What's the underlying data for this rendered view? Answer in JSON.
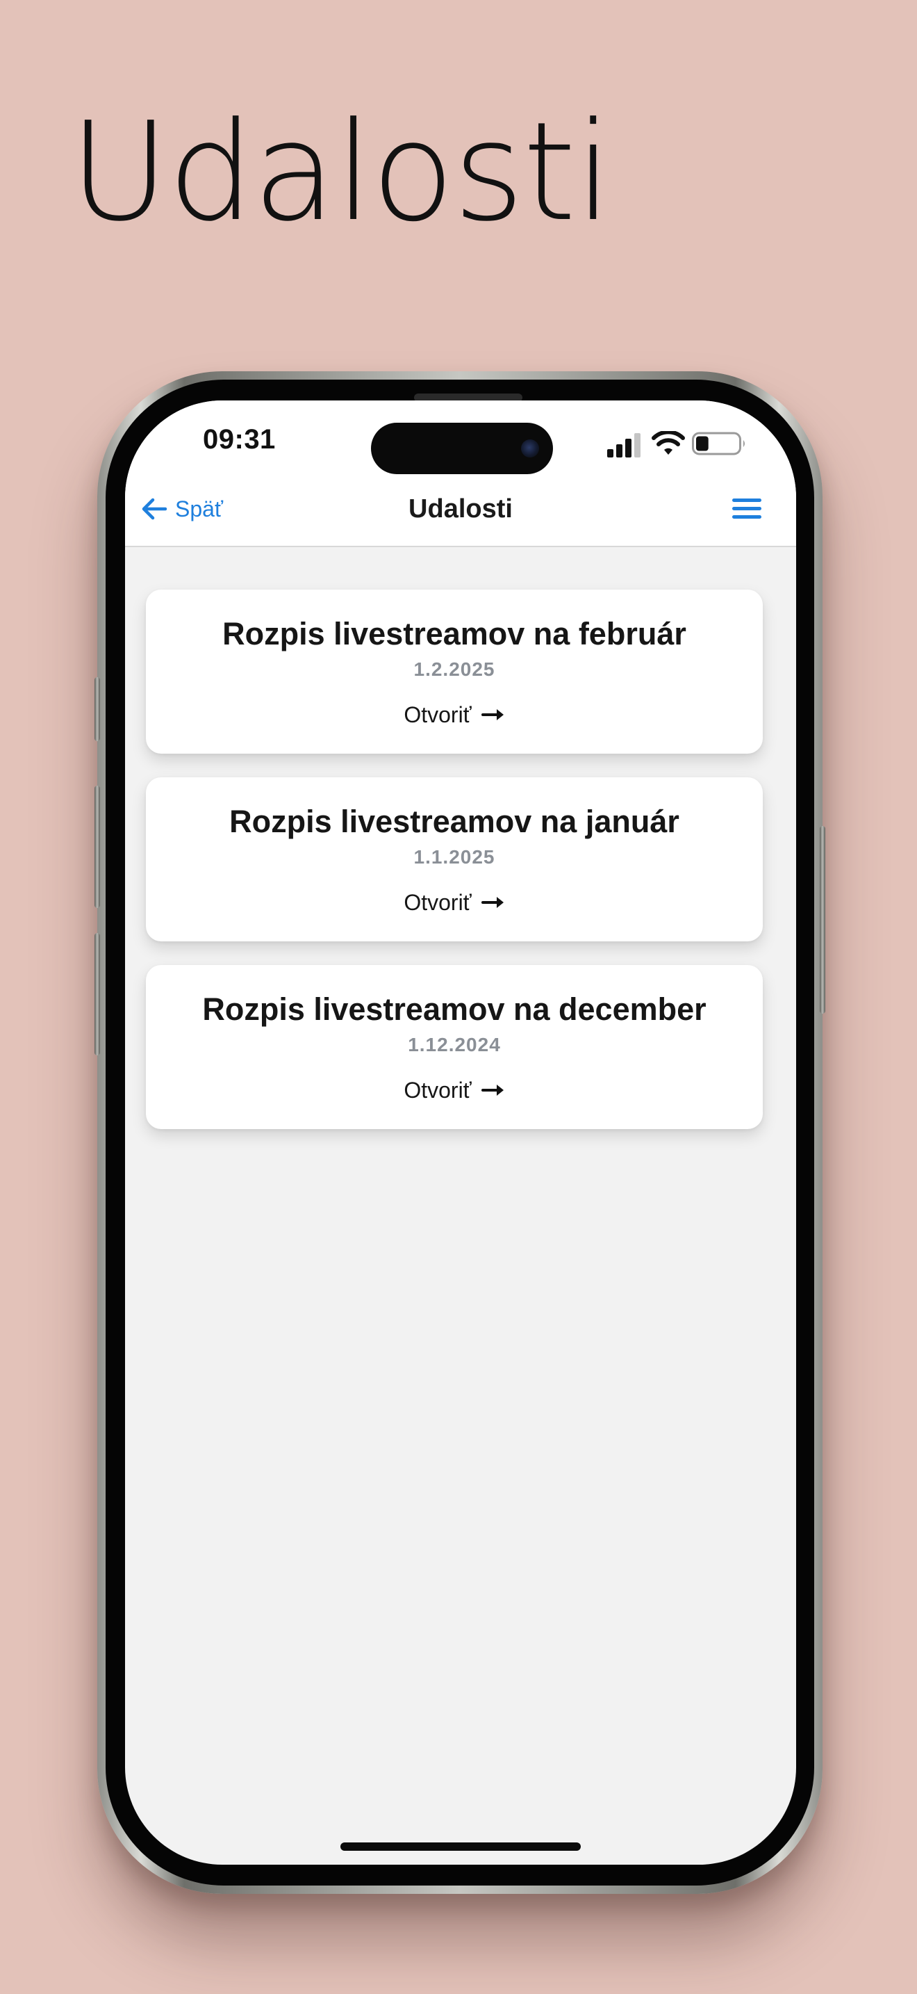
{
  "hero": {
    "title": "Udalosti"
  },
  "status_bar": {
    "time": "09:31",
    "icons": [
      "cellular-signal-icon",
      "wifi-icon",
      "battery-icon"
    ],
    "battery_level": 0.3
  },
  "nav": {
    "back_label": "Späť",
    "back_icon": "arrow-left-icon",
    "title": "Udalosti",
    "menu_icon": "hamburger-menu-icon"
  },
  "events": [
    {
      "title": "Rozpis livestreamov na február",
      "date": "1.2.2025",
      "open_label": "Otvoriť"
    },
    {
      "title": "Rozpis livestreamov na január",
      "date": "1.1.2025",
      "open_label": "Otvoriť"
    },
    {
      "title": "Rozpis livestreamov na december",
      "date": "1.12.2024",
      "open_label": "Otvoriť"
    }
  ],
  "colors": {
    "page_background": "#e3c2b9",
    "accent": "#1e7fdd",
    "screen_background": "#f2f2f2",
    "card_background": "#ffffff",
    "date_text": "#8a8f96"
  }
}
